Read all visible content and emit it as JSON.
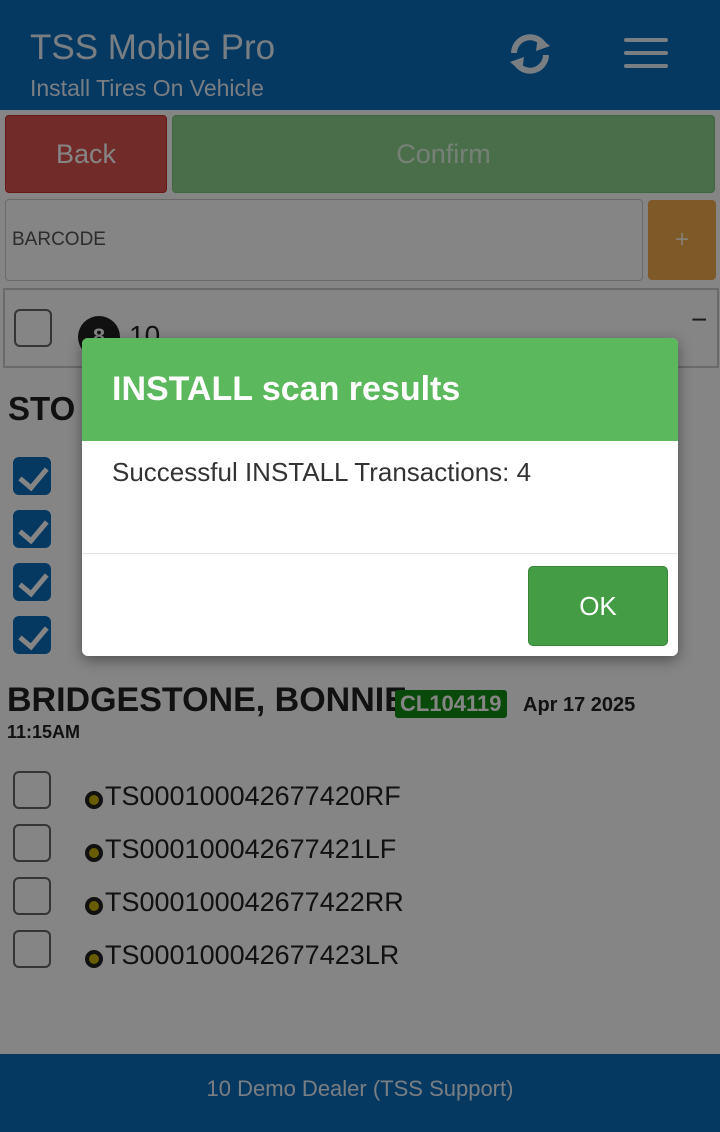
{
  "header": {
    "title": "TSS Mobile Pro",
    "subtitle": "Install Tires On Vehicle",
    "icons": [
      "refresh-icon",
      "menu-icon"
    ]
  },
  "actions": {
    "back_label": "Back",
    "confirm_label": "Confirm",
    "add_label": "+"
  },
  "barcode": {
    "placeholder": "BARCODE",
    "value": ""
  },
  "panel": {
    "badge": "8",
    "count": "10",
    "collapse_label": "−"
  },
  "store_heading": "STO",
  "section": {
    "name": "BRIDGESTONE, BONNIE",
    "code": "CL104119",
    "date": "Apr 17 2025",
    "time": "11:15AM"
  },
  "tires": [
    {
      "label": "TS000100042677420RF"
    },
    {
      "label": "TS000100042677421LF"
    },
    {
      "label": "TS000100042677422RR"
    },
    {
      "label": "TS000100042677423LR"
    }
  ],
  "footer": {
    "dealer": "10 Demo Dealer (TSS Support)"
  },
  "modal": {
    "title": "INSTALL scan results",
    "message": "Successful INSTALL Transactions: 4",
    "ok_label": "OK"
  },
  "colors": {
    "brand": "#0a6ebd",
    "danger": "#d9534f",
    "success": "#5cb85c",
    "warning": "#f0ad4e",
    "badge": "#128c12"
  }
}
